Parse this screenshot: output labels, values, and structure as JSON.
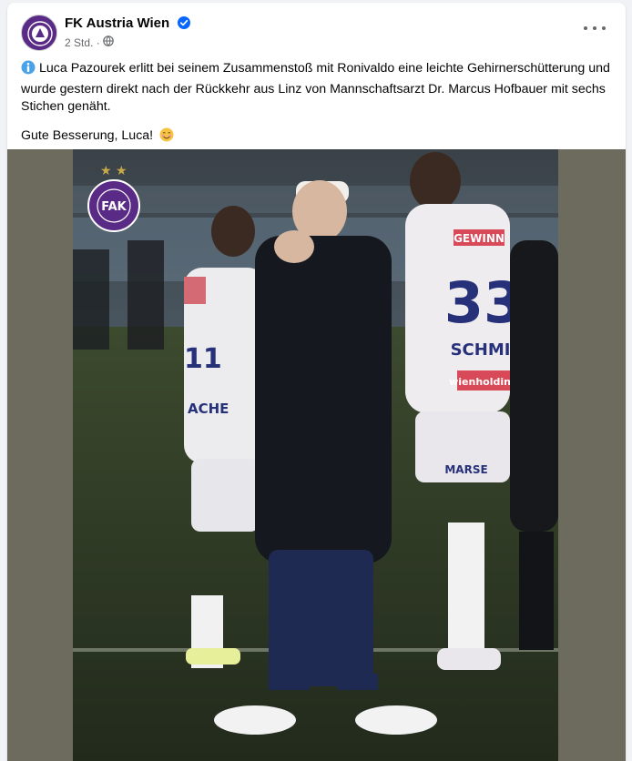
{
  "post": {
    "page_name": "FK Austria Wien",
    "timestamp": "2 Std.",
    "separator": "·",
    "text_main": "Luca Pazourek erlitt bei seinem Zusammenstoß mit Ronivaldo eine leichte Gehirnerschütterung und wurde gestern direkt nach der Rückkehr aus Linz von Mannschaftsarzt Dr. Marcus Hofbauer mit sechs Stichen genäht.",
    "text_second": "Gute Besserung, Luca!"
  },
  "photo": {
    "crest_ring_text": "FUSSBALLKLUB AUSTRIA WIEN",
    "crest_letters": "FAK",
    "sponsor_shorts": "MARSE",
    "sponsor_chest": "wienholding",
    "sponsor_back": "GEWINN",
    "player_number": "33",
    "player_name": "SCHMID",
    "left_player_name": "ACHE",
    "left_player_number": "11"
  },
  "colors": {
    "brand_purple": "#5a2b86",
    "verified_blue": "#0866ff",
    "side_band": "#6d6b5e"
  },
  "icons": [
    "verified-icon",
    "globe-icon",
    "more-options-icon",
    "info-icon",
    "smiling-face-emoji"
  ]
}
